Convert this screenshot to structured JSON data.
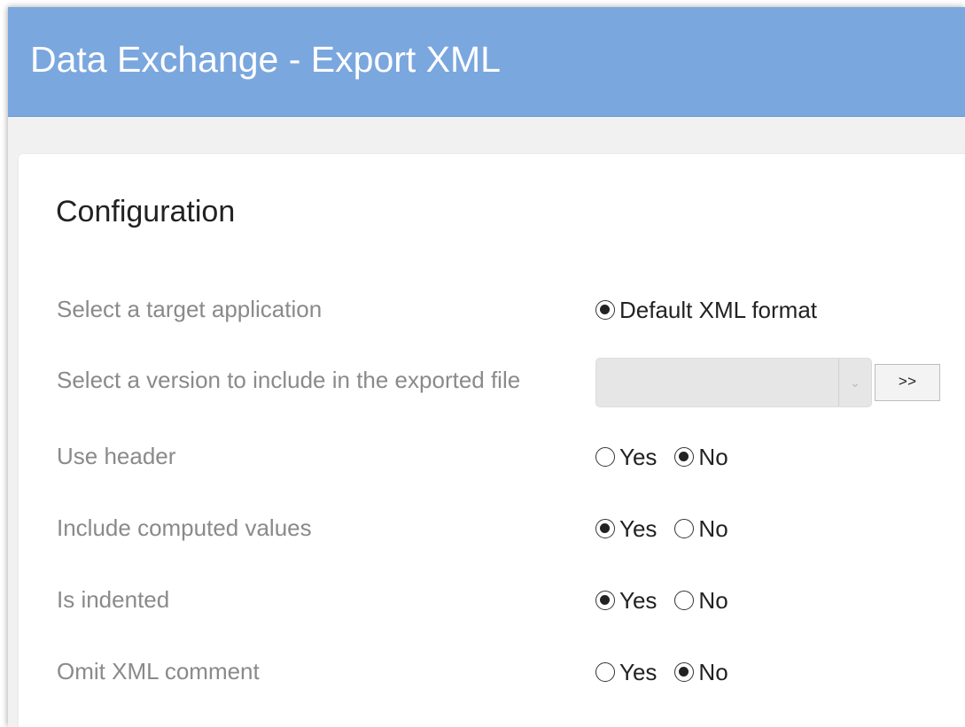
{
  "header": {
    "title": "Data Exchange - Export XML"
  },
  "section": {
    "title": "Configuration"
  },
  "target_application": {
    "label": "Select a target application",
    "options": [
      {
        "label": "Default XML format",
        "selected": true
      }
    ]
  },
  "version": {
    "label": "Select a version to include in the exported file",
    "selected_value": "",
    "button_label": ">>"
  },
  "use_header": {
    "label": "Use header",
    "options": [
      {
        "label": "Yes",
        "selected": false
      },
      {
        "label": "No",
        "selected": true
      }
    ]
  },
  "include_computed_values": {
    "label": "Include computed values",
    "options": [
      {
        "label": "Yes",
        "selected": true
      },
      {
        "label": "No",
        "selected": false
      }
    ]
  },
  "is_indented": {
    "label": "Is indented",
    "options": [
      {
        "label": "Yes",
        "selected": true
      },
      {
        "label": "No",
        "selected": false
      }
    ]
  },
  "omit_xml_comment": {
    "label": "Omit XML comment",
    "options": [
      {
        "label": "Yes",
        "selected": false
      },
      {
        "label": "No",
        "selected": true
      }
    ]
  },
  "colors": {
    "header_background": "#7ba7df",
    "header_text": "#ffffff",
    "label_text": "#8a8a8a",
    "value_text": "#222222",
    "page_background": "#f1f1f1",
    "card_background": "#ffffff"
  }
}
